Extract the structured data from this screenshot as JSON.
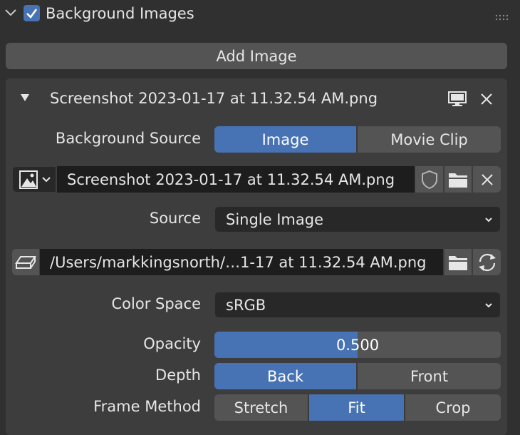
{
  "panel": {
    "title": "Background Images",
    "enabled": true,
    "add_image_label": "Add Image"
  },
  "image_entry": {
    "name": "Screenshot 2023-01-17 at 11.32.54 AM.png",
    "background_source": {
      "label": "Background Source",
      "options": [
        "Image",
        "Movie Clip"
      ],
      "selected": "Image"
    },
    "image_datablock": {
      "name": "Screenshot 2023-01-17 at 11.32.54 AM.png"
    },
    "source": {
      "label": "Source",
      "value": "Single Image"
    },
    "filepath": "/Users/markkingsnorth/…1-17 at 11.32.54 AM.png",
    "color_space": {
      "label": "Color Space",
      "value": "sRGB"
    },
    "opacity": {
      "label": "Opacity",
      "display": "0.500",
      "value": 0.5
    },
    "depth": {
      "label": "Depth",
      "options": [
        "Back",
        "Front"
      ],
      "selected": "Back"
    },
    "frame_method": {
      "label": "Frame Method",
      "options": [
        "Stretch",
        "Fit",
        "Crop"
      ],
      "selected": "Fit"
    }
  },
  "colors": {
    "accent": "#4772b3",
    "panel_bg": "#303030",
    "sub_panel_bg": "#3d3d3d",
    "button_bg": "#545454"
  }
}
